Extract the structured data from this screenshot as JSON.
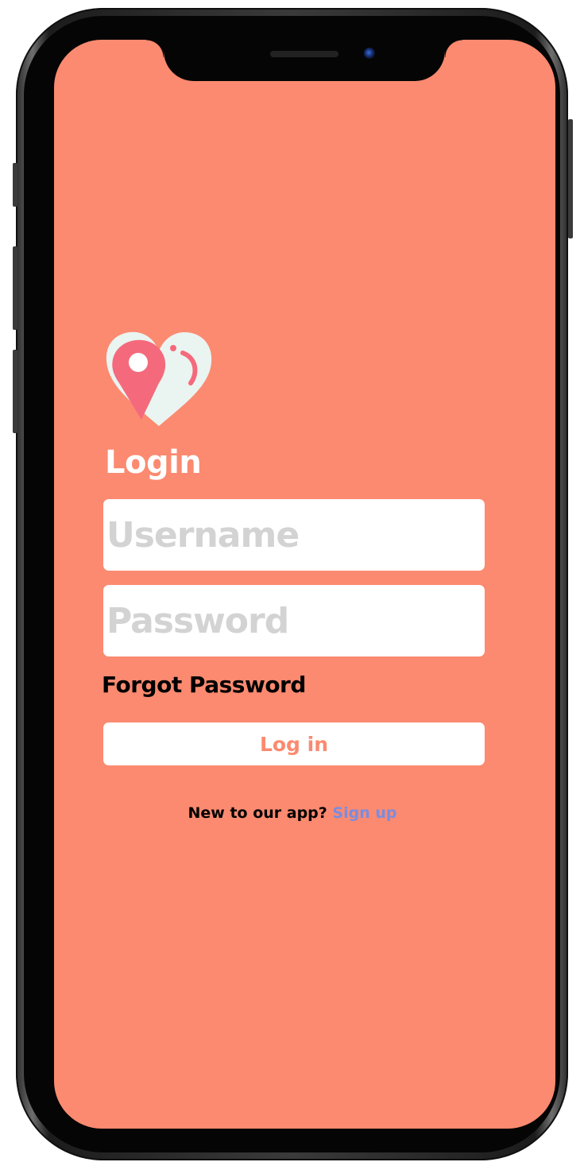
{
  "app": {
    "background_color": "#fb8a70",
    "logo_icon": "heart-location-pin-icon"
  },
  "login": {
    "title": "Login",
    "username_placeholder": "Username",
    "password_placeholder": "Password",
    "forgot_password": "Forgot Password",
    "login_button": "Log in"
  },
  "signup": {
    "prompt": "New to our app?",
    "link": "Sign up",
    "link_color": "#7b8cde"
  }
}
